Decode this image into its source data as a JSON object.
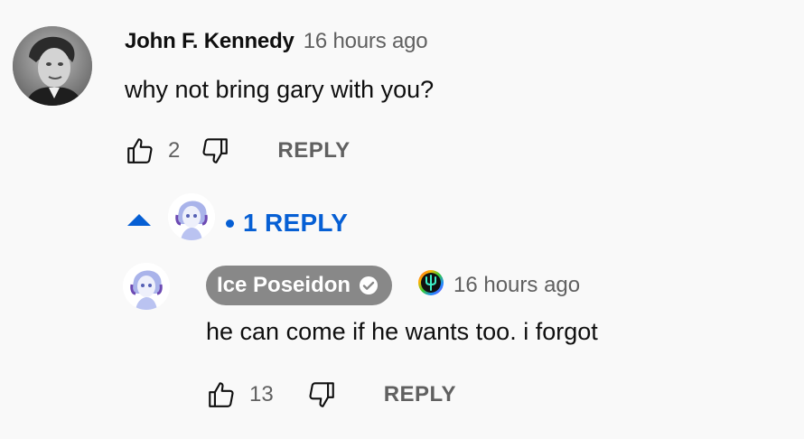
{
  "comment": {
    "author": "John F. Kennedy",
    "time": "16 hours ago",
    "text": "why not bring gary with you?",
    "like_count": "2",
    "reply_label": "REPLY",
    "replies_toggle_label": "1 REPLY"
  },
  "reply": {
    "author": "Ice Poseidon",
    "time": "16 hours ago",
    "text": "he can come if he wants too. i forgot",
    "like_count": "13",
    "reply_label": "REPLY"
  },
  "icons": {
    "like": "thumbs-up-icon",
    "dislike": "thumbs-down-icon",
    "expand": "caret-up-icon",
    "verified": "check-circle-icon",
    "badge": "rainbow-trident-icon"
  },
  "colors": {
    "background": "#f9f9f9",
    "link_blue": "#065fd4",
    "secondary_text": "#606060",
    "owner_badge": "#888888"
  }
}
